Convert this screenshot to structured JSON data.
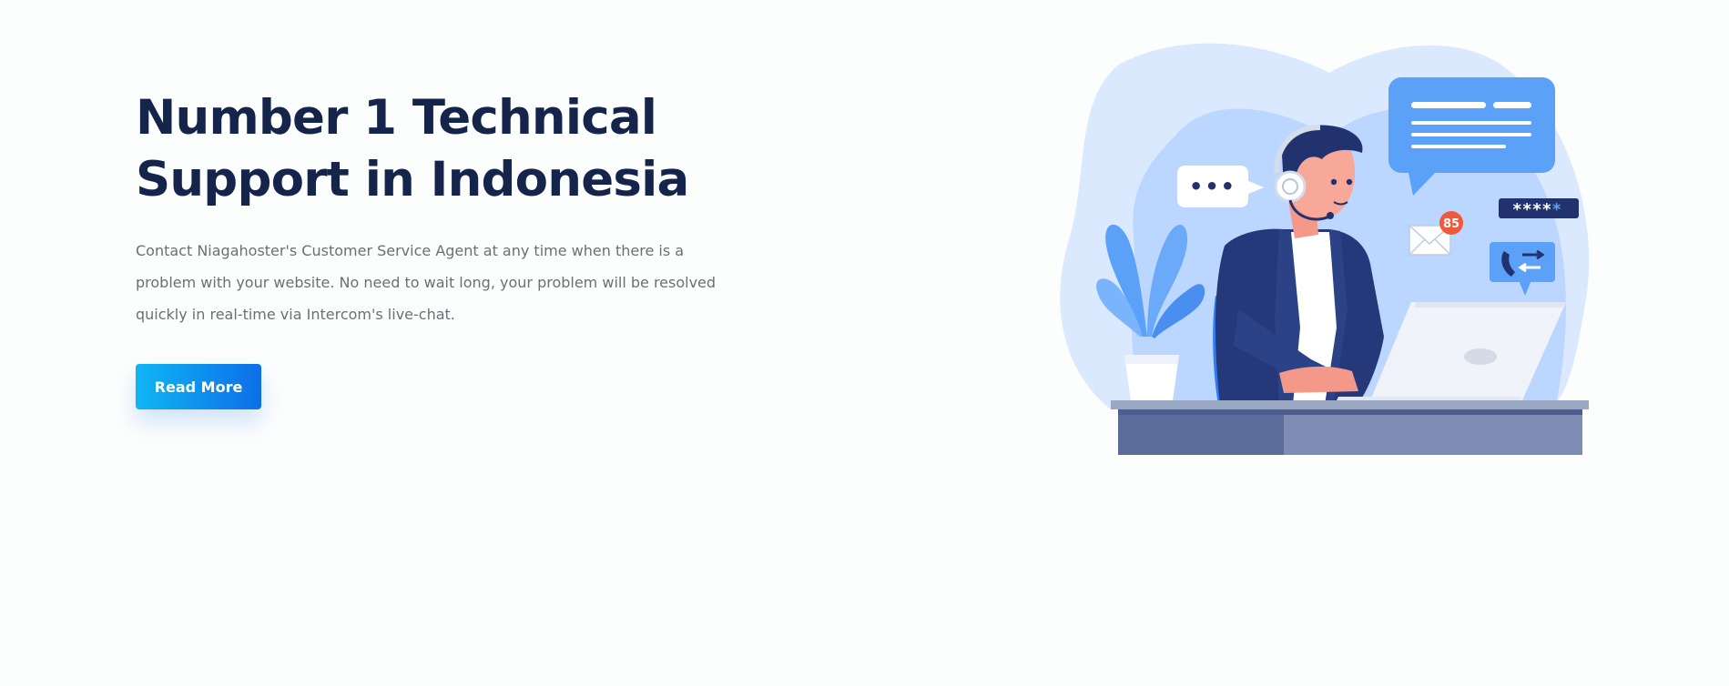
{
  "hero": {
    "title_line_1": "Number 1 Technical",
    "title_line_2": "Support in Indonesia",
    "description": "Contact Niagahoster's Customer Service Agent at any time when there is a problem with your website. No need to wait long, your problem will be resolved quickly in real-time via Intercom's live-chat.",
    "cta_label": "Read More"
  },
  "illustration": {
    "notification_count": "85",
    "password_mask": "****",
    "password_last": "*",
    "typing_dots": "•••",
    "icons": [
      "support-agent-illustration",
      "envelope-icon",
      "phone-transfer-icon",
      "chat-bubble-icon",
      "plant-icon",
      "laptop-icon",
      "headset-icon"
    ]
  },
  "colors": {
    "title": "#14244a",
    "body_text": "#6d6f75",
    "button_start": "#10b6f4",
    "button_end": "#0d6ee8",
    "blob_light": "#dbe9ff",
    "blob_mid": "#bcd7ff",
    "accent_blue": "#5aa1f7",
    "navy": "#25397a",
    "badge": "#f05a3a"
  }
}
